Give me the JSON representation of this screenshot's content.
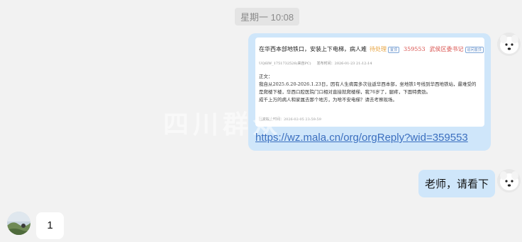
{
  "timestamp": "星期一 10:08",
  "messages": {
    "link_card": {
      "title": "在华西本部地铁口，安装上下电梯，病人难",
      "status": "待处理",
      "tag_left": "置顶",
      "number": "359553",
      "org": "武侯区委书记",
      "tag_right": "追问置顶",
      "author": "UQ6lW_1751732526(来自PC)",
      "time": "发布时间：2026-01-23 21:12:14",
      "body_label": "正文：",
      "body_line1": "我自从2025.6.20-2026.1.23日，因有人生病需多次往返华西本部，坐地铁1号线到华西地铁站，最难受的",
      "body_line2": "是爬楼下楼，华西口腔医院门口相对直接就爬楼梯，我76岁了，腿疼，下面特费劲。",
      "body_line3": "成千上万的病人和家属去那个地方，为啥不安电梯？请去考察现场。",
      "footer": "回复截止时间：2026-02-05 23:59:59",
      "watermark": "四川群众",
      "link": "https://wz.mala.cn/org/orgReply?wid=359553"
    },
    "teacher_message": "老师，请看下",
    "reply_message": "1"
  },
  "avatars": {
    "self": "dog-avatar",
    "other": "landscape-avatar"
  }
}
